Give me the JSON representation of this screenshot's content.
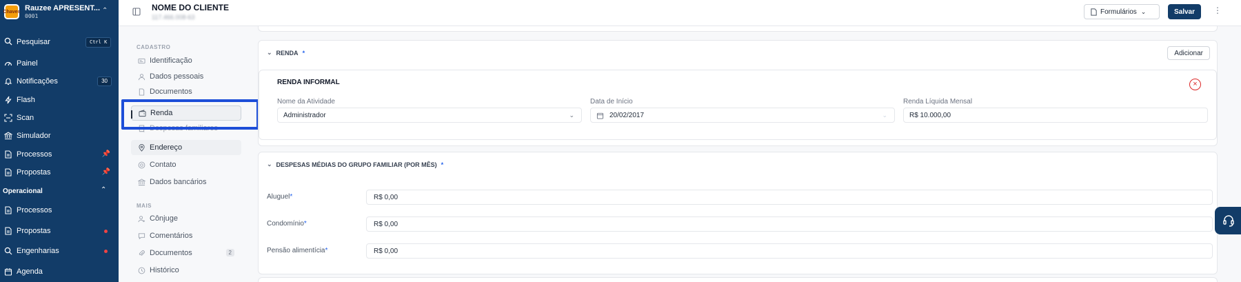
{
  "brand": {
    "logo_text": "Chaves",
    "name": "Rauzee APRESENT...",
    "code": "0001"
  },
  "search": {
    "label": "Pesquisar",
    "shortcut": "Ctrl K"
  },
  "sidebar": {
    "items": [
      {
        "label": "Painel",
        "icon": "dashboard-icon"
      },
      {
        "label": "Notificações",
        "icon": "bell-icon",
        "badge": "30"
      },
      {
        "label": "Flash",
        "icon": "lightning-icon"
      },
      {
        "label": "Scan",
        "icon": "scan-icon"
      },
      {
        "label": "Simulador",
        "icon": "bank-icon"
      },
      {
        "label": "Processos",
        "icon": "document-icon",
        "pinned": true
      },
      {
        "label": "Propostas",
        "icon": "document-icon",
        "pinned": true
      }
    ],
    "section": "Operacional",
    "section_items": [
      {
        "label": "Processos",
        "icon": "document-icon"
      },
      {
        "label": "Propostas",
        "icon": "document-icon",
        "dot": true
      },
      {
        "label": "Engenharias",
        "icon": "search-icon",
        "dot": true
      },
      {
        "label": "Agenda",
        "icon": "calendar-icon"
      }
    ]
  },
  "header": {
    "client_name": "NOME DO CLIENTE",
    "client_id": "117.466.008-63",
    "forms_label": "Formulários",
    "save_label": "Salvar"
  },
  "inner_nav": {
    "cadastro_label": "CADASTRO",
    "cadastro_items": [
      {
        "label": "Identificação",
        "icon": "id-card-icon"
      },
      {
        "label": "Dados pessoais",
        "icon": "user-icon"
      },
      {
        "label": "Documentos",
        "icon": "document-icon"
      },
      {
        "label": "Renda",
        "icon": "wallet-icon",
        "active": true
      },
      {
        "label": "Despesas familiares",
        "icon": "receipt-icon"
      },
      {
        "label": "Endereço",
        "icon": "location-icon"
      },
      {
        "label": "Contato",
        "icon": "at-icon"
      },
      {
        "label": "Dados bancários",
        "icon": "bank-icon"
      }
    ],
    "mais_label": "MAIS",
    "mais_items": [
      {
        "label": "Cônjuge",
        "icon": "user-plus-icon"
      },
      {
        "label": "Comentários",
        "icon": "chat-icon"
      },
      {
        "label": "Documentos",
        "icon": "paperclip-icon",
        "count": "2"
      },
      {
        "label": "Histórico",
        "icon": "history-icon"
      }
    ]
  },
  "renda": {
    "title": "RENDA",
    "required_mark": "*",
    "add_label": "Adicionar",
    "entry_title": "RENDA INFORMAL",
    "fields": {
      "atividade_label": "Nome da Atividade",
      "atividade_value": "Administrador",
      "inicio_label": "Data de Início",
      "inicio_value": "20/02/2017",
      "renda_label": "Renda Líquida Mensal",
      "renda_value": "R$ 10.000,00"
    }
  },
  "despesas": {
    "title": "DESPESAS MÉDIAS DO GRUPO FAMILIAR (POR MÊS)",
    "required_mark": "*",
    "rows": [
      {
        "label": "Aluguel",
        "value": "R$ 0,00"
      },
      {
        "label": "Condomínio",
        "value": "R$ 0,00"
      },
      {
        "label": "Pensão alimentícia",
        "value": "R$ 0,00"
      }
    ]
  },
  "colors": {
    "sidebar_bg": "#123c68",
    "primary": "#123c68",
    "highlight": "#1d4ed8",
    "danger": "#dc2626",
    "pin": "#facc15"
  }
}
